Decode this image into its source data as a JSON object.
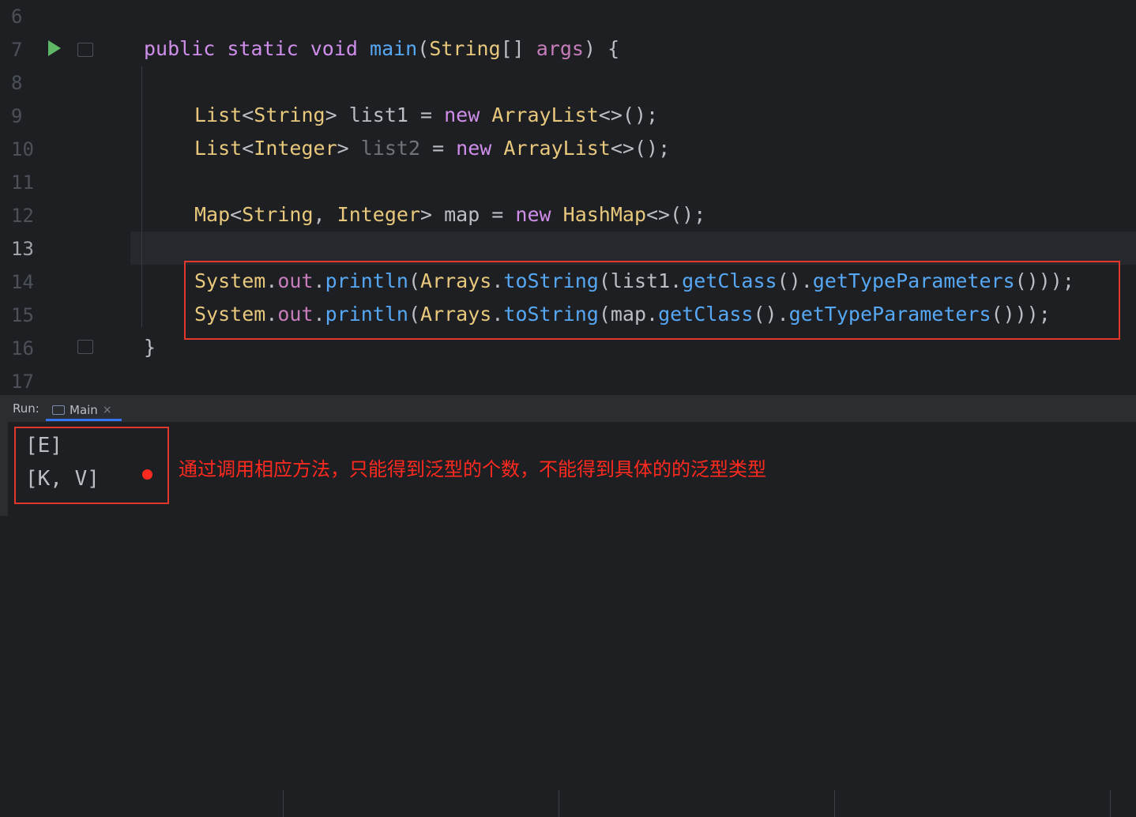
{
  "editor": {
    "line_numbers": [
      "6",
      "7",
      "8",
      "9",
      "10",
      "11",
      "12",
      "13",
      "14",
      "15",
      "16",
      "17"
    ],
    "current_line": "13",
    "lines": {
      "l7": {
        "kw1": "public",
        "kw2": "static",
        "kw3": "void",
        "fn": "main",
        "p1": "(",
        "ty": "String",
        "p2": "[] ",
        "par": "args",
        "p3": ") {"
      },
      "l9": {
        "ty1": "List",
        "p1": "<",
        "ty2": "String",
        "p2": "> list1 = ",
        "kw": "new",
        "ty3": "ArrayList",
        "p3": "<>();"
      },
      "l10": {
        "ty1": "List",
        "p1": "<",
        "ty2": "Integer",
        "p2": "> ",
        "dim": "list2",
        "p3": " = ",
        "kw": "new",
        "ty3": "ArrayList",
        "p4": "<>();"
      },
      "l12": {
        "ty1": "Map",
        "p1": "<",
        "ty2": "String",
        "p2": ", ",
        "ty3": "Integer",
        "p3": "> map = ",
        "kw": "new",
        "ty4": "HashMap",
        "p4": "<>();"
      },
      "l14": {
        "ty1": "System",
        "p1": ".",
        "field": "out",
        "p2": ".",
        "fn1": "println",
        "p3": "(",
        "ty2": "Arrays",
        "p4": ".",
        "fn2": "toString",
        "p5": "(list1.",
        "fn3": "getClass",
        "p6": "().",
        "fn4": "getTypeParameters",
        "p7": "()));"
      },
      "l15": {
        "ty1": "System",
        "p1": ".",
        "field": "out",
        "p2": ".",
        "fn1": "println",
        "p3": "(",
        "ty2": "Arrays",
        "p4": ".",
        "fn2": "toString",
        "p5": "(map.",
        "fn3": "getClass",
        "p6": "().",
        "fn4": "getTypeParameters",
        "p7": "()));"
      },
      "l16": "}"
    }
  },
  "run_panel": {
    "label": "Run:",
    "tab_label": "Main",
    "close_glyph": "×"
  },
  "console": {
    "output": [
      "[E]",
      "[K, V]"
    ]
  },
  "annotation": "通过调用相应方法，只能得到泛型的个数，不能得到具体的的泛型类型",
  "colors": {
    "highlight_border": "#e0392b",
    "annotation": "#ff2a1f",
    "run_icon": "#5fb865"
  }
}
